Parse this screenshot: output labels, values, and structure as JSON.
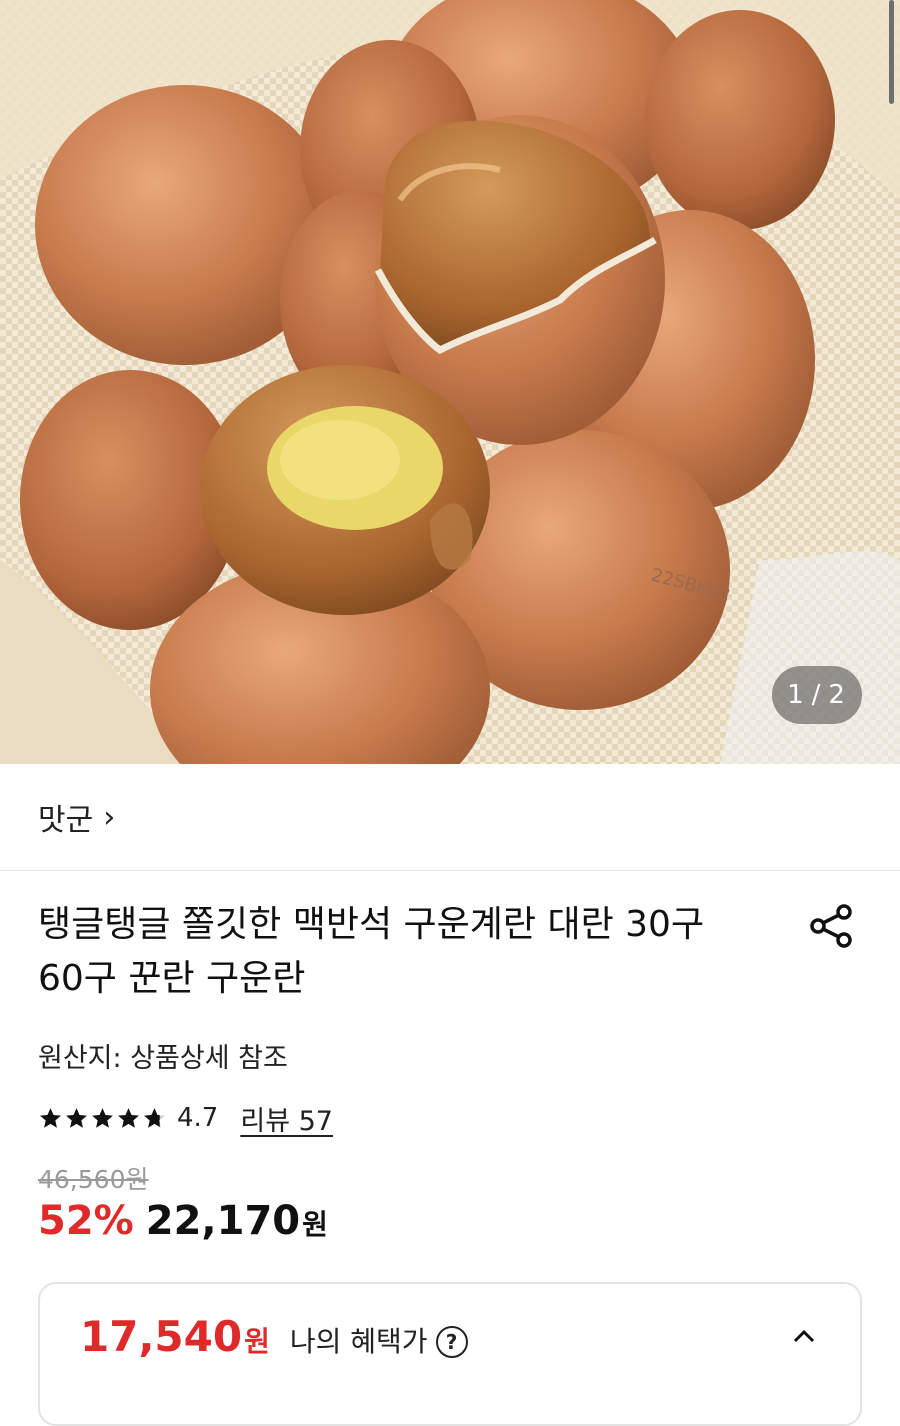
{
  "gallery": {
    "current": "1",
    "separator": "/",
    "total": "2"
  },
  "seller": {
    "name": "맛군",
    "chevron": "›"
  },
  "product": {
    "title": "탱글탱글 쫄깃한 맥반석 구운계란 대란 30구 60구 꾼란 구운란",
    "origin": "원산지: 상품상세 참조",
    "rating": "4.7",
    "review_text": "리뷰 57",
    "stars_filled": 4.7
  },
  "price": {
    "original": "46,560원",
    "discount": "52%",
    "sale": "22,170",
    "sale_unit": "원"
  },
  "benefit": {
    "price": "17,540",
    "unit": "원",
    "label": "나의 혜택가",
    "help": "?"
  },
  "colors": {
    "accent_red": "#e02a2a",
    "text": "#111111",
    "muted": "#9a9a9a"
  },
  "icons": {
    "share": "share-icon",
    "help": "question-circle-icon",
    "collapse": "chevron-up-icon",
    "star": "star-icon"
  }
}
